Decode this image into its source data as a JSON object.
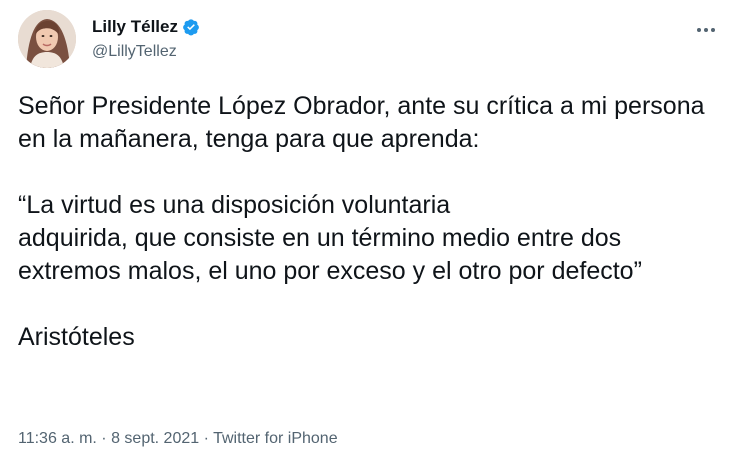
{
  "user": {
    "display_name": "Lilly Téllez",
    "handle": "@LillyTellez",
    "verified": true,
    "verified_color": "#1d9bf0"
  },
  "tweet": {
    "paragraph1": "Señor Presidente López Obrador, ante su crítica a mi persona en la mañanera, tenga para que aprenda:",
    "paragraph2": "“La virtud es una disposición voluntaria\nadquirida, que consiste en un término medio entre dos extremos malos, el uno por exceso y el otro por defecto”",
    "paragraph3": "Aristóteles"
  },
  "meta": {
    "time": "11:36 a. m.",
    "separator1": " · ",
    "date": "8 sept. 2021",
    "separator2": " · ",
    "source": "Twitter for iPhone"
  },
  "icons": {
    "more": "more-options-icon",
    "verified": "verified-badge-icon"
  }
}
